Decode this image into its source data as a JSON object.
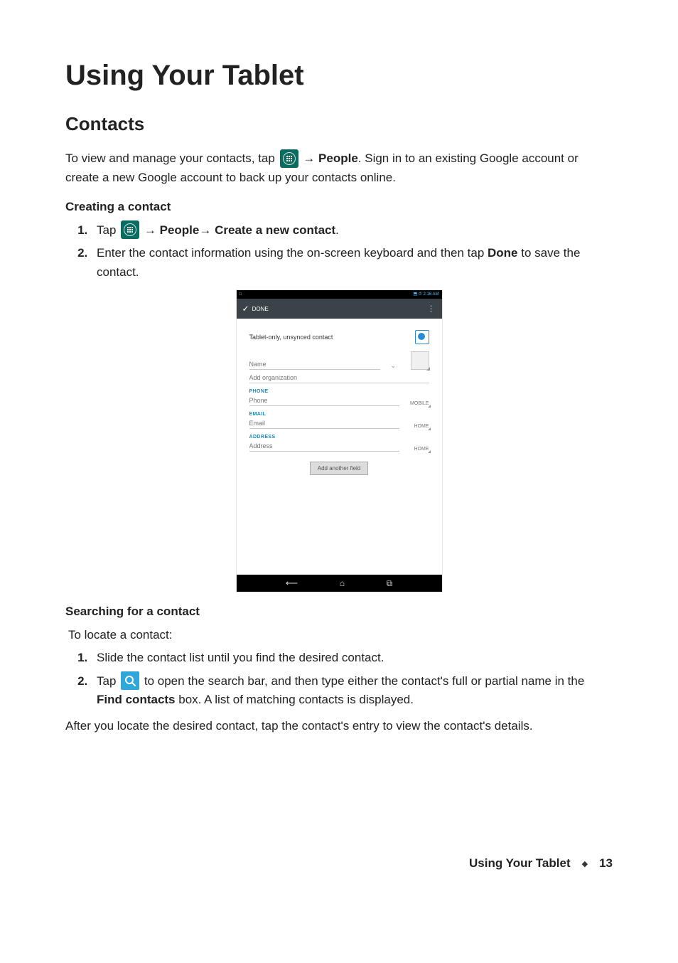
{
  "page": {
    "title": "Using Your Tablet",
    "footer_name": "Using Your Tablet",
    "footer_page": "13"
  },
  "section": {
    "heading": "Contacts",
    "intro_before": "To view and manage your contacts, tap ",
    "intro_mid": "→ ",
    "intro_people": "People",
    "intro_after": ". Sign in to an existing Google account or create a new Google account to back up your contacts online."
  },
  "creating": {
    "heading": "Creating a contact",
    "step1_before": "Tap ",
    "step1_mid": "→ ",
    "step1_people": "People",
    "step1_arrow": "→ ",
    "step1_create": "Create a new contact",
    "step1_end": ".",
    "step2_before": "Enter the contact information using the on-screen keyboard and then tap ",
    "step2_done": "Done",
    "step2_after": " to save the contact."
  },
  "screenshot": {
    "statusbar": {
      "left_icon": "□",
      "right_icons": "⬒ ⏱",
      "time": "2:16 AM"
    },
    "done_label": "DONE",
    "menu_dots": "⋮",
    "account_label": "Tablet-only, unsynced contact",
    "name_placeholder": "Name",
    "add_org": "Add organization",
    "section_phone": "PHONE",
    "phone_placeholder": "Phone",
    "phone_type": "MOBILE",
    "section_email": "EMAIL",
    "email_placeholder": "Email",
    "email_type": "HOME",
    "section_address": "ADDRESS",
    "address_placeholder": "Address",
    "address_type": "HOME",
    "add_another": "Add another field"
  },
  "searching": {
    "heading": "Searching for a contact",
    "lead": "To locate a contact:",
    "step1": "Slide the contact list until you find the desired contact.",
    "step2_before": "Tap ",
    "step2_after1": " to open the search bar, and then type either the contact's full or partial name in the ",
    "step2_bold": "Find contacts",
    "step2_after2": " box. A list of matching contacts is displayed.",
    "after": "After you locate the desired contact, tap the contact's entry to view the contact's details."
  }
}
